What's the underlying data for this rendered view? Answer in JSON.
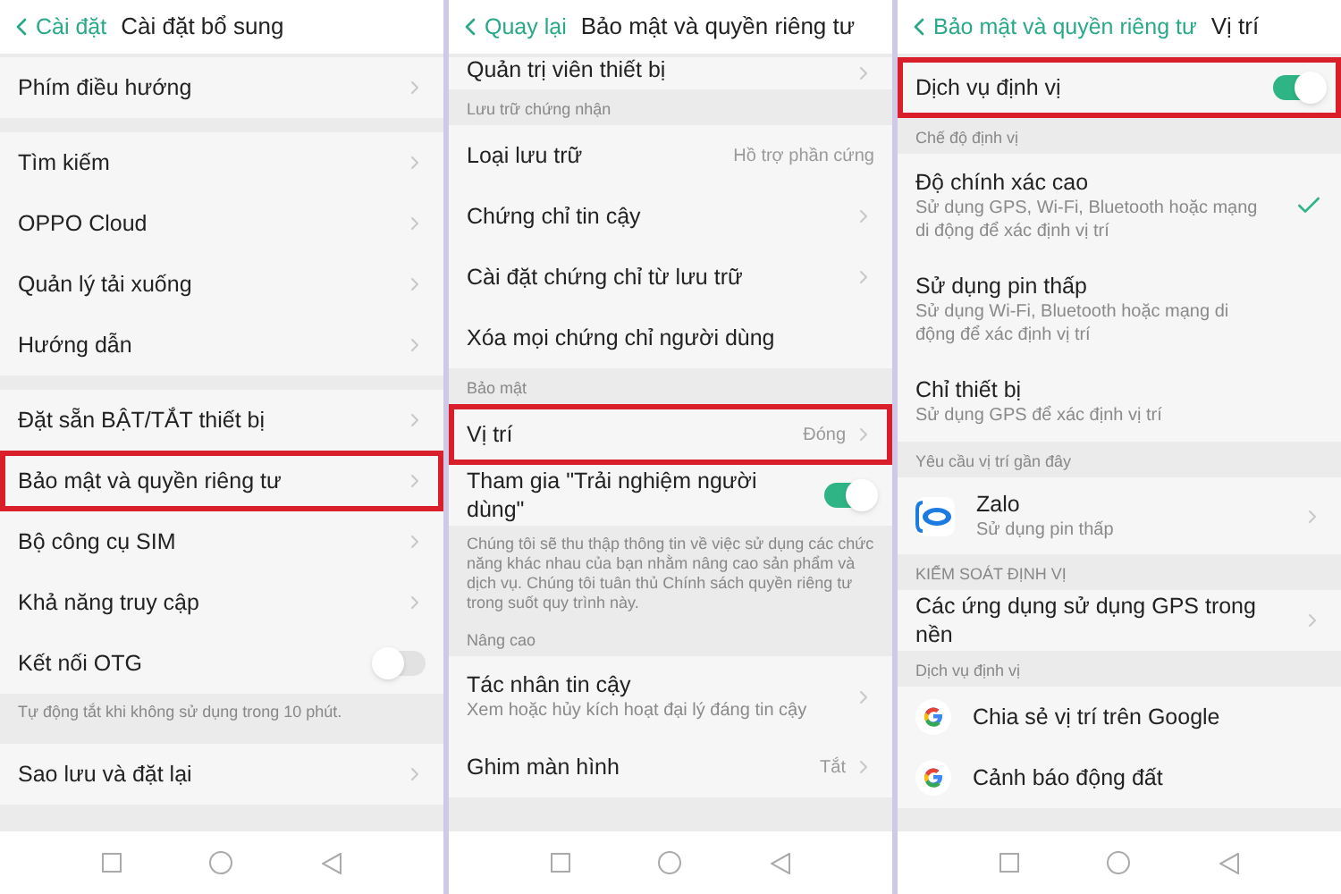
{
  "panels": [
    {
      "back_label": "Cài đặt",
      "title": "Cài đặt bổ sung",
      "sections": [
        {
          "items": [
            {
              "kind": "link",
              "label": "Phím điều hướng",
              "highlighted": false
            }
          ]
        },
        {
          "items": [
            {
              "kind": "link",
              "label": "Tìm kiếm",
              "highlighted": false
            },
            {
              "kind": "link",
              "label": "OPPO Cloud",
              "highlighted": false
            },
            {
              "kind": "link",
              "label": "Quản lý tải xuống",
              "highlighted": false
            },
            {
              "kind": "link",
              "label": "Hướng dẫn",
              "highlighted": false
            }
          ]
        },
        {
          "items": [
            {
              "kind": "link",
              "label": "Đặt sẵn BẬT/TẮT thiết bị",
              "highlighted": false
            },
            {
              "kind": "link",
              "label": "Bảo mật và quyền riêng tư",
              "highlighted": true
            },
            {
              "kind": "link",
              "label": "Bộ công cụ SIM",
              "highlighted": false
            },
            {
              "kind": "link",
              "label": "Khả năng truy cập",
              "highlighted": false
            },
            {
              "kind": "toggle",
              "label": "Kết nối OTG",
              "on": false,
              "highlighted": false
            }
          ],
          "footer": "Tự động tắt khi không sử dụng trong 10 phút."
        },
        {
          "items": [
            {
              "kind": "link",
              "label": "Sao lưu và đặt lại",
              "highlighted": false
            }
          ]
        }
      ]
    },
    {
      "back_label": "Quay lại",
      "title": "Bảo mật và quyền riêng tư",
      "sections": [
        {
          "items": [
            {
              "kind": "partial",
              "label": "Quản trị viên thiết bị",
              "highlighted": false
            }
          ]
        },
        {
          "header": "Lưu trữ chứng nhận",
          "items": [
            {
              "kind": "info",
              "label": "Loại lưu trữ",
              "value": "Hồ trợ phần cứng",
              "highlighted": false
            },
            {
              "kind": "link",
              "label": "Chứng chỉ tin cậy",
              "highlighted": false
            },
            {
              "kind": "link",
              "label": "Cài đặt chứng chỉ từ lưu trữ",
              "highlighted": false
            },
            {
              "kind": "info",
              "label": "Xóa mọi chứng chỉ người dùng",
              "highlighted": false
            }
          ]
        },
        {
          "header": "Bảo mật",
          "items": [
            {
              "kind": "link",
              "label": "Vị trí",
              "value": "Đóng",
              "highlighted": true
            },
            {
              "kind": "toggle",
              "label": "Tham gia \"Trải nghiệm người dùng\"",
              "on": true,
              "highlighted": false
            }
          ],
          "footer": "Chúng tôi sẽ thu thập thông tin về việc sử dụng các chức năng khác nhau của bạn nhằm nâng cao sản phẩm và dịch vụ. Chúng tôi tuân thủ Chính sách quyền riêng tư trong suốt quy trình này."
        },
        {
          "header": "Nâng cao",
          "items": [
            {
              "kind": "link",
              "label": "Tác nhân tin cậy",
              "subtitle": "Xem hoặc hủy kích hoạt đại lý đáng tin cậy",
              "highlighted": false
            },
            {
              "kind": "link",
              "label": "Ghim màn hình",
              "value": "Tắt",
              "highlighted": false
            }
          ]
        }
      ]
    },
    {
      "back_label": "Bảo mật và quyền riêng tư",
      "title": "Vị trí",
      "sections": [
        {
          "items": [
            {
              "kind": "toggle",
              "label": "Dịch vụ định vị",
              "on": true,
              "highlighted": true
            }
          ]
        },
        {
          "header": "Chế độ định vị",
          "items": [
            {
              "kind": "choice",
              "label": "Độ chính xác cao",
              "subtitle": "Sử dụng GPS, Wi-Fi, Bluetooth hoặc mạng di động để xác định vị trí",
              "selected": true,
              "highlighted": false
            },
            {
              "kind": "choice",
              "label": "Sử dụng pin thấp",
              "subtitle": "Sử dụng Wi-Fi, Bluetooth hoặc mạng di động để xác định vị trí",
              "selected": false,
              "highlighted": false
            },
            {
              "kind": "choice",
              "label": "Chỉ thiết bị",
              "subtitle": "Sử dụng GPS để xác định vị trí",
              "selected": false,
              "highlighted": false
            }
          ]
        },
        {
          "header": "Yêu cầu vị trí gần đây",
          "items": [
            {
              "kind": "app",
              "label": "Zalo",
              "subtitle": "Sử dụng pin thấp",
              "highlighted": false
            }
          ]
        },
        {
          "header": "KIỂM SOÁT ĐỊNH VỊ",
          "items": [
            {
              "kind": "link",
              "label": "Các ứng dụng sử dụng GPS trong nền",
              "highlighted": false
            }
          ]
        },
        {
          "header": "Dịch vụ định vị",
          "items": [
            {
              "kind": "service",
              "label": "Chia sẻ vị trí trên Google",
              "highlighted": false
            },
            {
              "kind": "service",
              "label": "Cảnh báo động đất",
              "highlighted": false
            }
          ]
        }
      ]
    }
  ]
}
